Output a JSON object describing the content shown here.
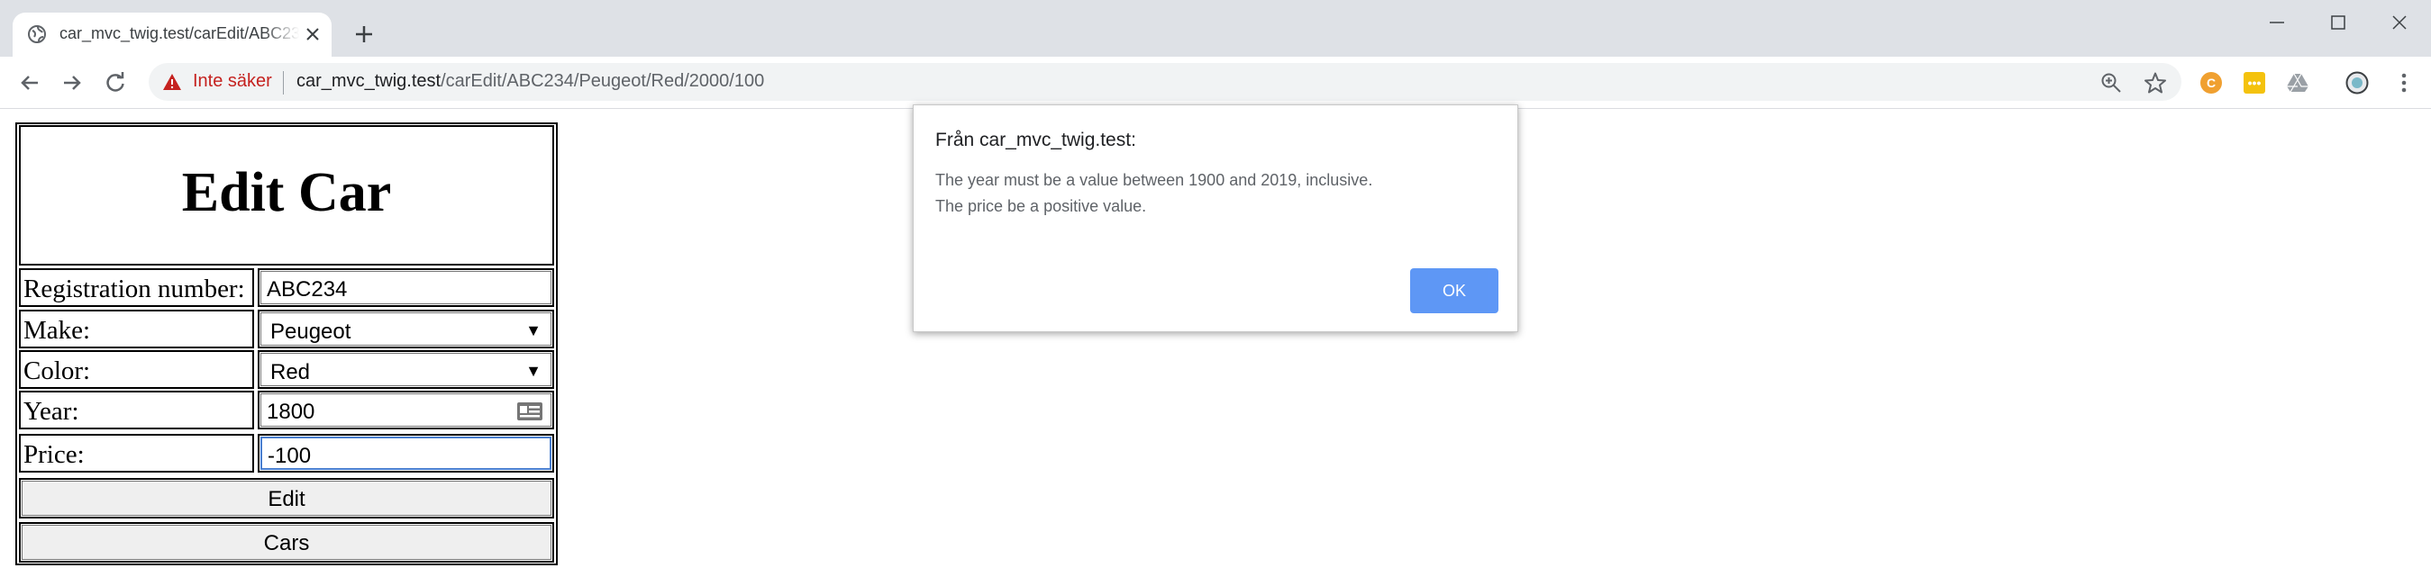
{
  "browser": {
    "tab_title": "car_mvc_twig.test/carEdit/ABC234/Peugeot/Red/2000/100",
    "not_secure_label": "Inte säker",
    "url_host": "car_mvc_twig.test",
    "url_path": "/carEdit/ABC234/Peugeot/Red/2000/100",
    "warning_color": "#c5221f"
  },
  "page": {
    "heading": "Edit Car",
    "fields": {
      "registration": {
        "label": "Registration number:",
        "value": "ABC234"
      },
      "make": {
        "label": "Make:",
        "value": "Peugeot"
      },
      "color": {
        "label": "Color:",
        "value": "Red"
      },
      "year": {
        "label": "Year:",
        "value": "1800"
      },
      "price": {
        "label": "Price:",
        "value": "-100"
      }
    },
    "edit_button": "Edit",
    "cars_button": "Cars"
  },
  "dialog": {
    "title": "Från car_mvc_twig.test:",
    "message_line1": "The year must be a value between 1900 and 2019, inclusive.",
    "message_line2": "The price be a positive value.",
    "ok_label": "OK",
    "ok_color": "#4285f4"
  },
  "icons": {
    "select_arrow": "▼"
  }
}
